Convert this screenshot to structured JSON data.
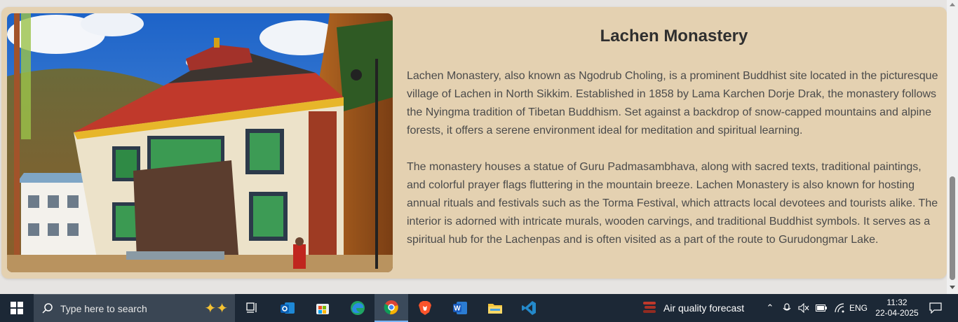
{
  "article": {
    "title": "Lachen Monastery",
    "paragraphs": [
      "Lachen Monastery, also known as Ngodrub Choling, is a prominent Buddhist site located in the picturesque village of Lachen in North Sikkim. Established in 1858 by Lama Karchen Dorje Drak, the monastery follows the Nyingma tradition of Tibetan Buddhism. Set against a backdrop of snow-capped mountains and alpine forests, it offers a serene environment ideal for meditation and spiritual learning.",
      "The monastery houses a statue of Guru Padmasambhava, along with sacred texts, traditional paintings, and colorful prayer flags fluttering in the mountain breeze. Lachen Monastery is also known for hosting annual rituals and festivals such as the Torma Festival, which attracts local devotees and tourists alike. The interior is adorned with intricate murals, wooden carvings, and traditional Buddhist symbols. It serves as a spiritual hub for the Lachenpas and is often visited as a part of the route to Gurudongmar Lake."
    ],
    "image_subject": "Lachen Monastery building with prayer flags and pine forest"
  },
  "taskbar": {
    "search_placeholder": "Type here to search",
    "apps": [
      "task-view",
      "outlook",
      "microsoft-store",
      "edge",
      "chrome",
      "brave",
      "word",
      "file-explorer",
      "vscode"
    ],
    "active_app": "chrome",
    "weather_label": "Air quality forecast",
    "language": "ENG",
    "time": "11:32",
    "date": "22-04-2025"
  },
  "colors": {
    "card_bg": "#e4d1b1",
    "page_bg": "#e6e4e2",
    "taskbar_bg": "#1c2836",
    "title_color": "#2f2f2f",
    "text_color": "#4b4b4b"
  }
}
